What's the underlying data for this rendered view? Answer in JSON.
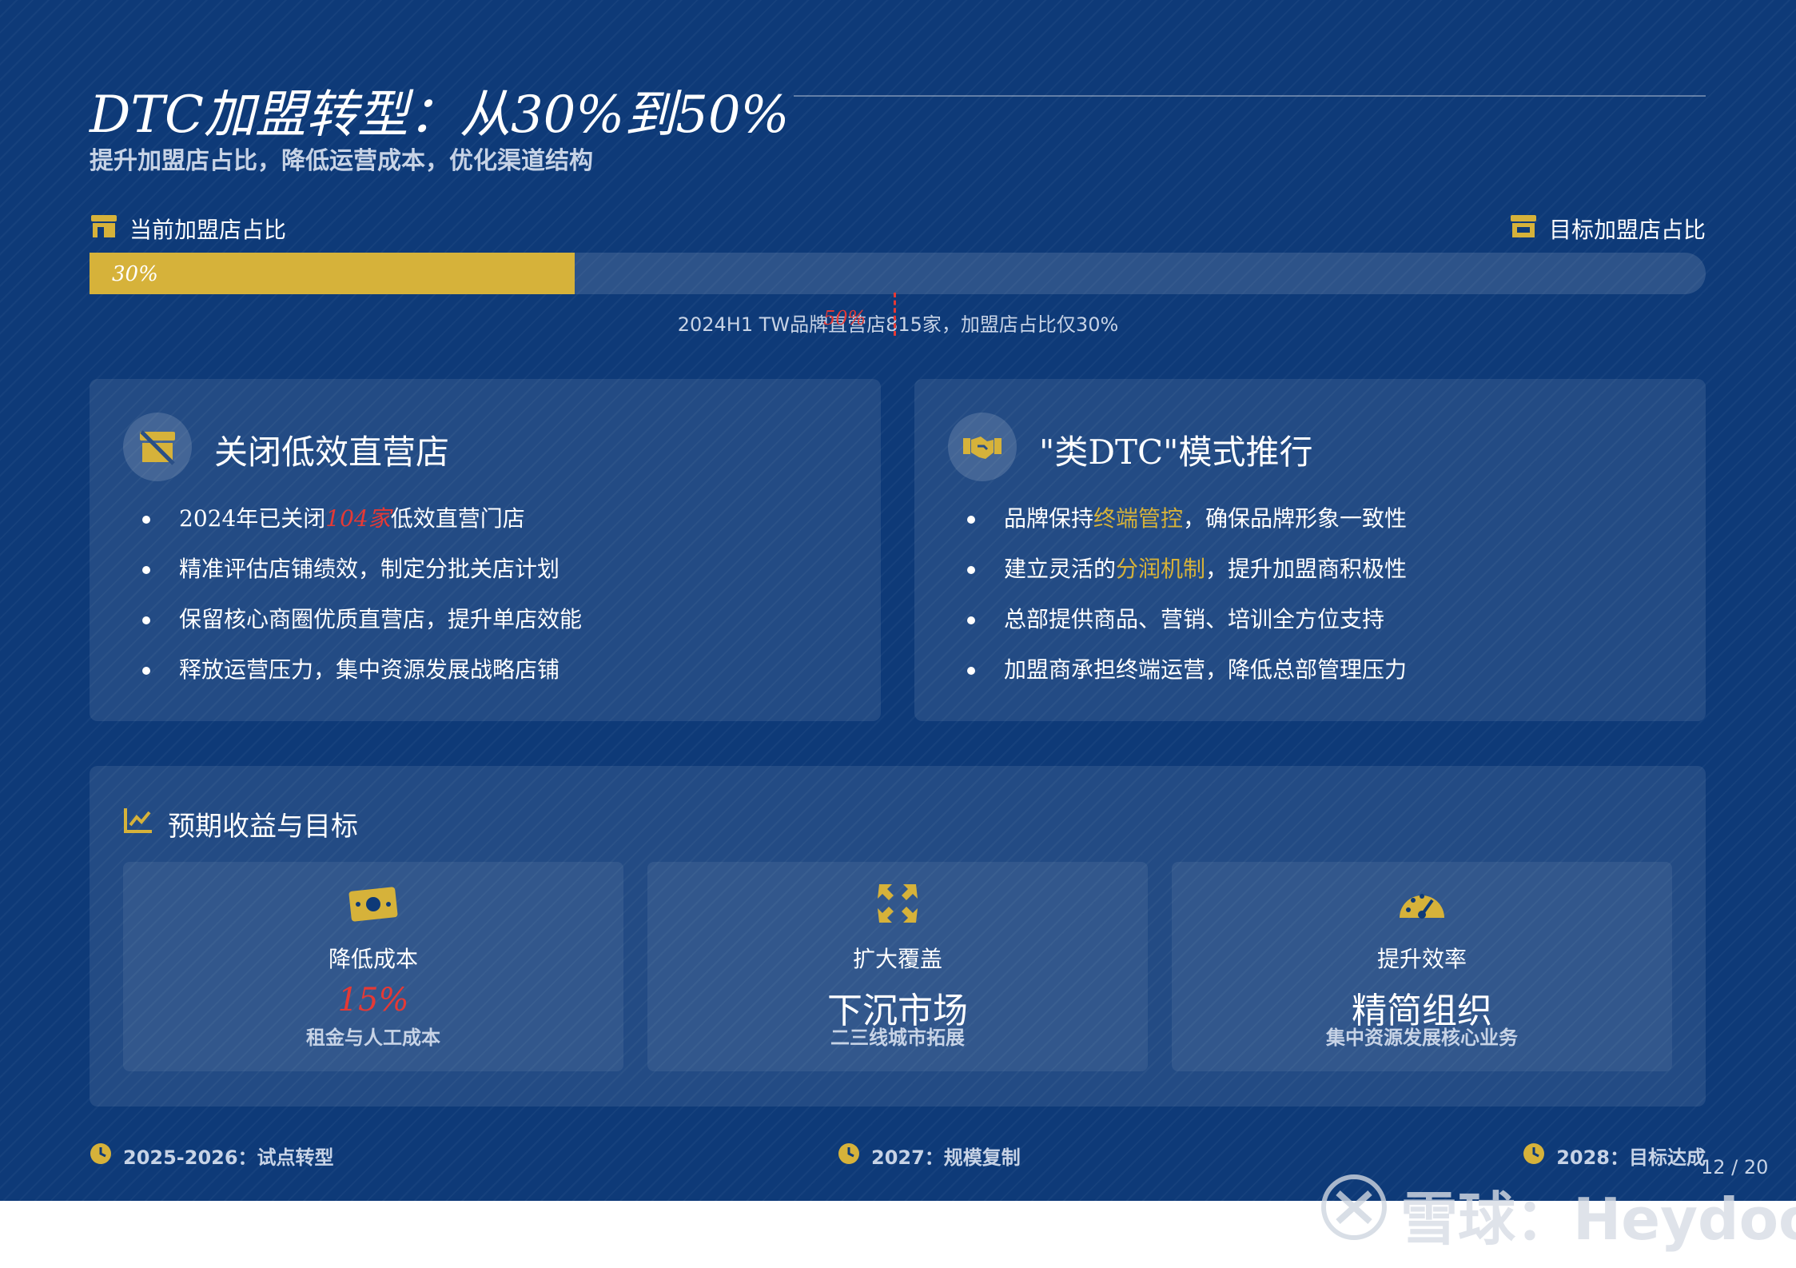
{
  "header": {
    "title": "DTC加盟转型：从30%到50%",
    "subtitle": "提升加盟店占比，降低运营成本，优化渠道结构"
  },
  "progress": {
    "current_label": "当前加盟店占比",
    "target_label": "目标加盟店占比",
    "current_value": 0.3,
    "target_value": 0.5,
    "current_text": "30%",
    "target_text": "50%",
    "note": "2024H1 TW品牌直营店815家，加盟店占比仅30%"
  },
  "left_card": {
    "title": "关闭低效直营店",
    "icon": "store-closed-icon",
    "bullets": {
      "b1_prefix": "2024年已关闭",
      "b1_highlight": "104家",
      "b1_suffix": "低效直营门店",
      "b2": "精准评估店铺绩效，制定分批关店计划",
      "b3": "保留核心商圈优质直营店，提升单店效能",
      "b4": "释放运营压力，集中资源发展战略店铺"
    }
  },
  "right_card": {
    "title": "\"类DTC\"模式推行",
    "icon": "handshake-icon",
    "bullets": {
      "b1_prefix": "品牌保持",
      "b1_highlight": "终端管控",
      "b1_suffix": "，确保品牌形象一致性",
      "b2_prefix": "建立灵活的",
      "b2_highlight": "分润机制",
      "b2_suffix": "，提升加盟商积极性",
      "b3": "总部提供商品、营销、培训全方位支持",
      "b4": "加盟商承担终端运营，降低总部管理压力"
    }
  },
  "benefits": {
    "title": "预期收益与目标",
    "items": [
      {
        "icon": "money-icon",
        "label": "降低成本",
        "value": "15%",
        "sub": "租金与人工成本"
      },
      {
        "icon": "expand-icon",
        "label": "扩大覆盖",
        "value": "下沉市场",
        "sub": "二三线城市拓展"
      },
      {
        "icon": "gauge-icon",
        "label": "提升效率",
        "value": "精简组织",
        "sub": "集中资源发展核心业务"
      }
    ]
  },
  "timeline": {
    "m1": "2025-2026：试点转型",
    "m2": "2027：规模复制",
    "m3": "2028：目标达成"
  },
  "page_number": "12 / 20",
  "watermark": "雪球：Heydoo",
  "colors": {
    "background": "#0e3a78",
    "accent_gold": "#d6b23a",
    "accent_red": "#e53935"
  }
}
